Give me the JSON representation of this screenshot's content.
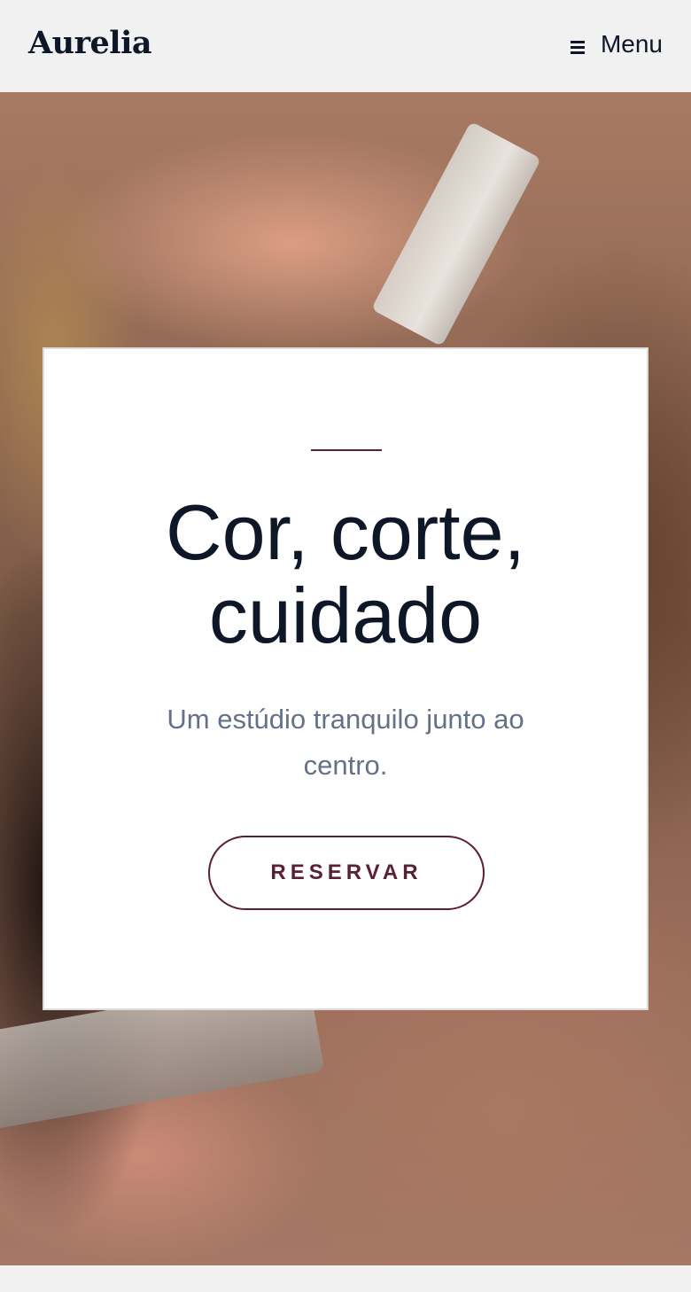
{
  "header": {
    "brand": "Aurelia",
    "menu_label": "Menu",
    "menu_icon": "hamburger-icon"
  },
  "hero": {
    "background_description_icon": "barber-photo",
    "title": "Cor, corte, cuidado",
    "subtitle": "Um estúdio tranquilo junto ao centro.",
    "cta_label": "RESERVAR"
  },
  "colors": {
    "accent": "#5b1f33",
    "heading": "#0d1727",
    "body_text": "#637288",
    "page_background": "#f1f1f1"
  }
}
